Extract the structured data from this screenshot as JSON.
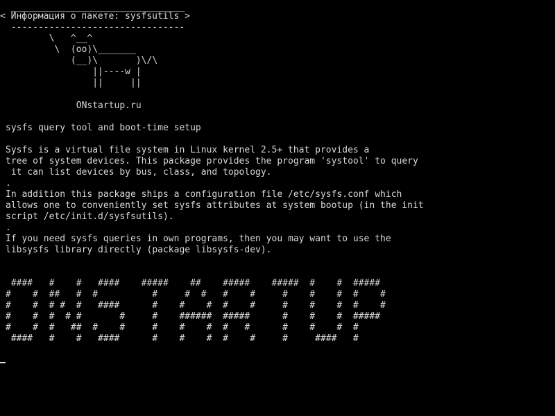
{
  "terminal": {
    "cowsay": {
      "border_top": " ________________________________",
      "title": "< Информация о пакете: sysfsutils >",
      "border_bottom": " --------------------------------",
      "cow": [
        "        \\   ^__^",
        "         \\  (oo)\\_______",
        "            (__)\\       )\\/\\",
        "                ||----w |",
        "                ||     ||"
      ]
    },
    "site": "             ONstartup.ru",
    "summary": "sysfs query tool and boot-time setup",
    "description": [
      "Sysfs is a virtual file system in Linux kernel 2.5+ that provides a",
      "tree of system devices. This package provides the program 'systool' to query",
      " it can list devices by bus, class, and topology.",
      ".",
      "In addition this package ships a configuration file /etc/sysfs.conf which",
      "allows one to conveniently set sysfs attributes at system bootup (in the init",
      "script /etc/init.d/sysfsutils).",
      ".",
      "If you need sysfs queries in own programs, then you may want to use the",
      "libsysfs library directly (package libsysfs-dev)."
    ],
    "banner": [
      " ####   #    #   ####    #####    ##    #####    #####  #    #  #####",
      "#    #  ##   #  #          #     #  #   #    #     #    #    #  #    #",
      "#    #  # #  #   ####      #    #    #  #    #     #    #    #  #    #",
      "#    #  #  # #       #     #    ######  #####      #    #    #  #####",
      "#    #  #   ##  #    #     #    #    #  #   #      #    #    #  #",
      " ####   #    #   ####      #    #    #  #    #     #     ####   #"
    ]
  }
}
